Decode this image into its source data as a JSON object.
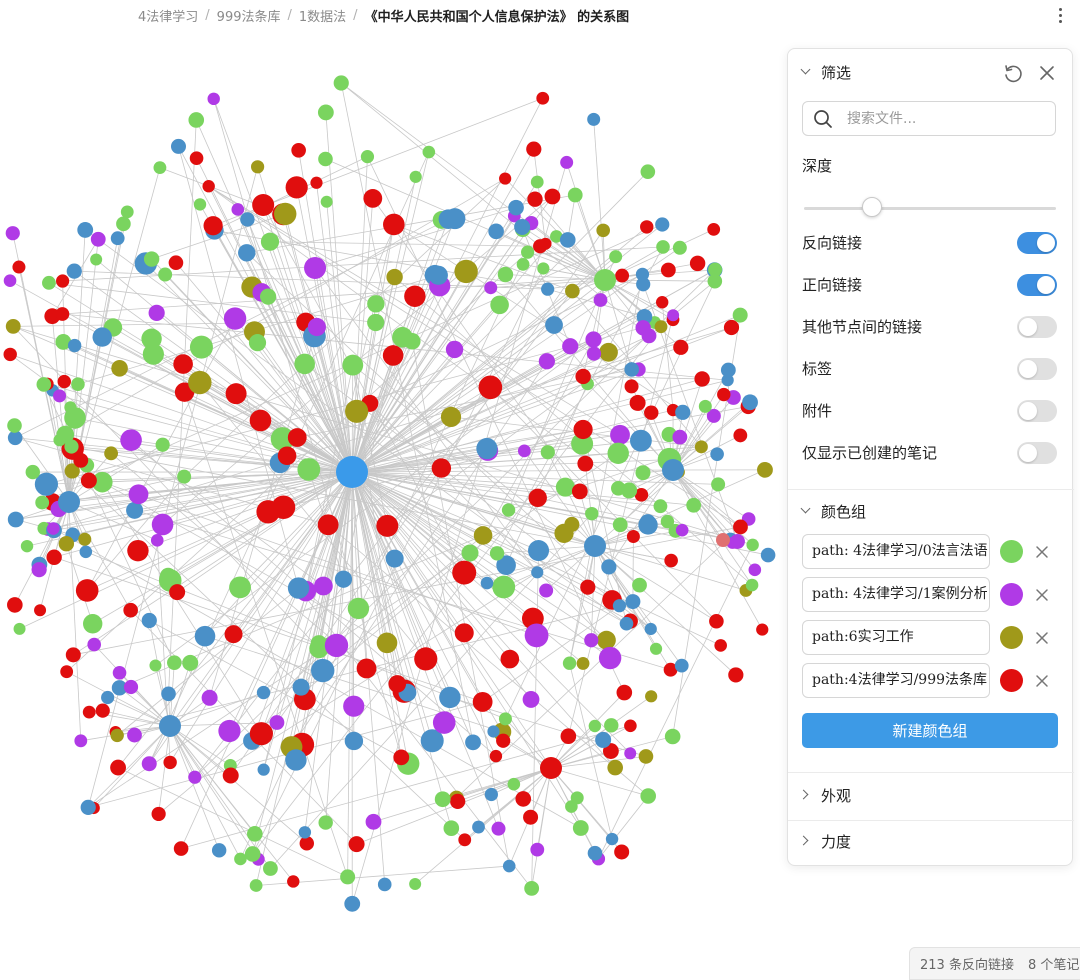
{
  "breadcrumb": {
    "items": [
      "4法律学习",
      "999法条库",
      "1数据法"
    ],
    "separator": "/",
    "current": "《中华人民共和国个人信息保护法》 的关系图"
  },
  "filter_panel": {
    "filter_section": {
      "title": "筛选",
      "search_placeholder": "搜索文件...",
      "depth_label": "深度",
      "depth_value": 0.27,
      "toggles": [
        {
          "label": "反向链接",
          "on": true
        },
        {
          "label": "正向链接",
          "on": true
        },
        {
          "label": "其他节点间的链接",
          "on": false
        },
        {
          "label": "标签",
          "on": false
        },
        {
          "label": "附件",
          "on": false
        },
        {
          "label": "仅显示已创建的笔记",
          "on": false
        }
      ]
    },
    "color_groups": {
      "title": "颜色组",
      "groups": [
        {
          "query": "path: 4法律学习/0法言法语",
          "color": "#7ad45f"
        },
        {
          "query": "path: 4法律学习/1案例分析",
          "color": "#b03ae6"
        },
        {
          "query": "path:6实习工作",
          "color": "#a0991a"
        },
        {
          "query": "path:4法律学习/999法条库",
          "color": "#e00e0e"
        }
      ],
      "new_group_label": "新建颜色组"
    },
    "appearance_title": "外观",
    "forces_title": "力度"
  },
  "status_bar": {
    "backlinks": "213 条反向链接",
    "notes": "8 个笔记"
  },
  "graph": {
    "colors": {
      "green": "#7ad45f",
      "purple": "#b03ae6",
      "olive": "#a0991a",
      "red": "#e00e0e",
      "blue": "#4a90c8",
      "center_blue": "#3a9aea",
      "pink": "#e07070",
      "edge": "#c8c8c8"
    }
  }
}
